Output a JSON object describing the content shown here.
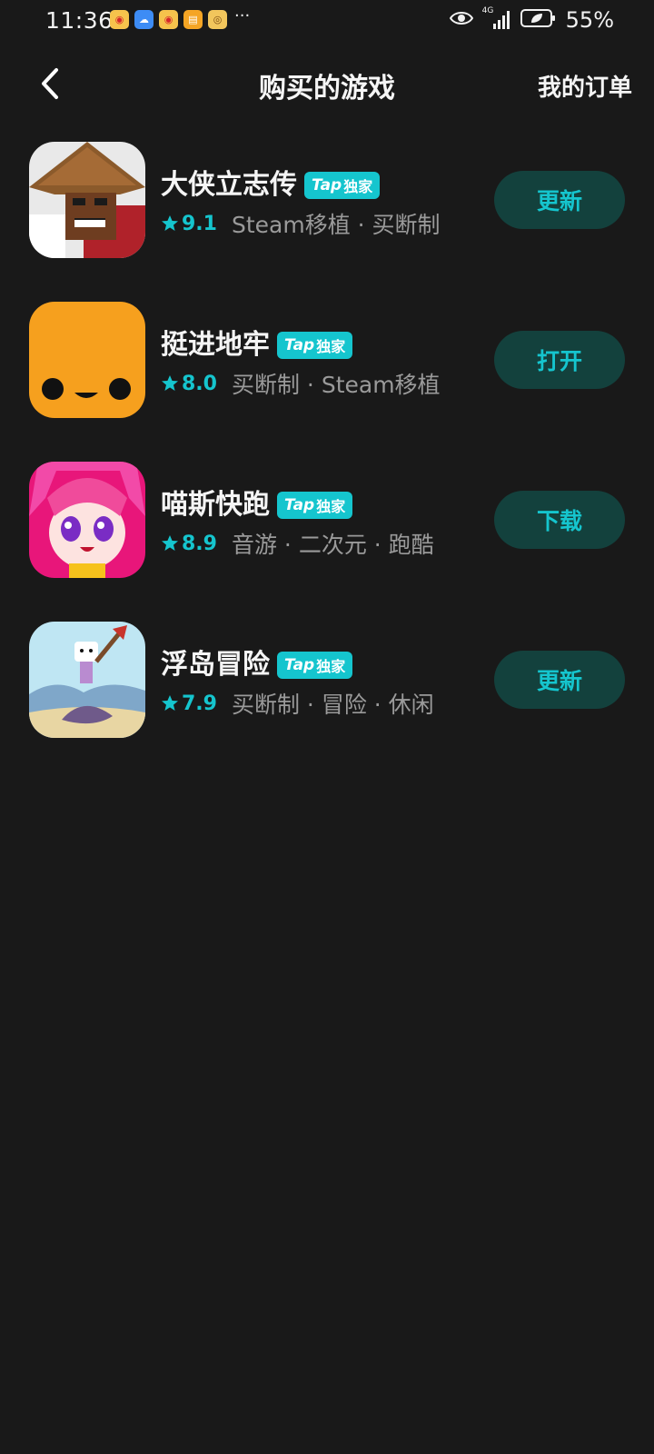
{
  "status_bar": {
    "time": "11:36",
    "more": "···",
    "network": "4G",
    "battery": "55%",
    "app_icons": [
      {
        "name": "weibo-icon",
        "color": "#f6c34c",
        "glyph": "◉"
      },
      {
        "name": "cloud-icon",
        "color": "#3d8cf5",
        "glyph": "☁"
      },
      {
        "name": "weibo-icon",
        "color": "#f6c34c",
        "glyph": "◉"
      },
      {
        "name": "notes-icon",
        "color": "#f5a524",
        "glyph": "▤"
      },
      {
        "name": "target-icon",
        "color": "#f2c65c",
        "glyph": "◎"
      }
    ]
  },
  "header": {
    "title": "购买的游戏",
    "orders_label": "我的订单"
  },
  "colors": {
    "background": "#191919",
    "accent": "#15c5ce",
    "button_bg": "#13413d",
    "tag_text": "#9a9a9a"
  },
  "games": [
    {
      "name": "大侠立志传",
      "badge_tap": "Tap",
      "badge_text": "独家",
      "rating": "9.1",
      "tags": "Steam移植 · 买断制",
      "action": "更新",
      "icon": "swordsman-game-icon"
    },
    {
      "name": "挺进地牢",
      "badge_tap": "Tap",
      "badge_text": "独家",
      "rating": "8.0",
      "tags": "买断制 · Steam移植",
      "action": "打开",
      "icon": "bullet-face-game-icon"
    },
    {
      "name": "喵斯快跑",
      "badge_tap": "Tap",
      "badge_text": "独家",
      "rating": "8.9",
      "tags": "音游 · 二次元 · 跑酷",
      "action": "下载",
      "icon": "anime-girl-game-icon"
    },
    {
      "name": "浮岛冒险",
      "badge_tap": "Tap",
      "badge_text": "独家",
      "rating": "7.9",
      "tags": "买断制 · 冒险 · 休闲",
      "action": "更新",
      "icon": "island-adventure-game-icon"
    }
  ]
}
